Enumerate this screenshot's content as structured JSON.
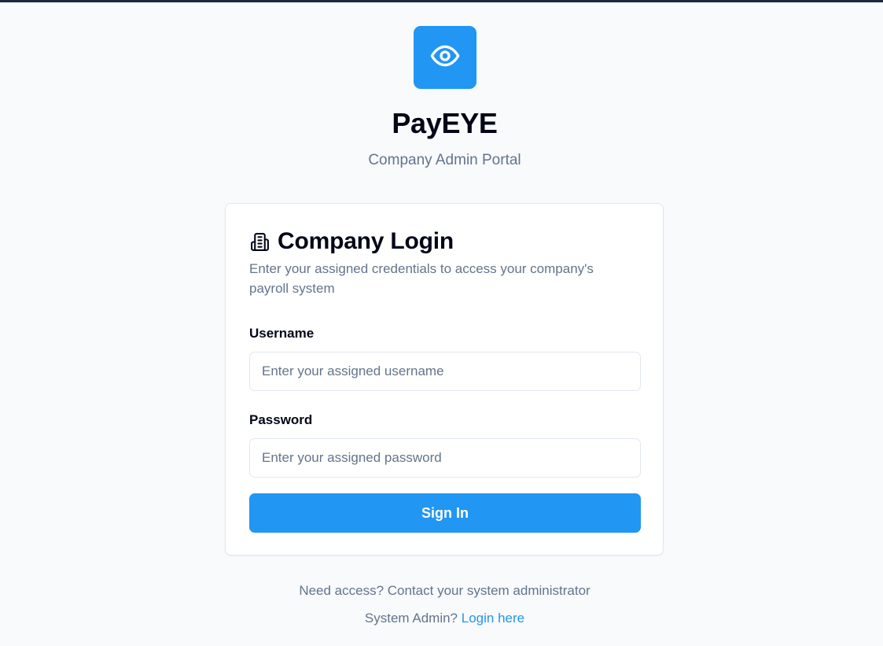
{
  "brand": {
    "name": "PayEYE",
    "subtitle": "Company Admin Portal",
    "logo_icon": "eye-icon",
    "accent_color": "#2196f3"
  },
  "login_card": {
    "icon": "building-icon",
    "title": "Company Login",
    "description": "Enter your assigned credentials to access your company's payroll system",
    "username": {
      "label": "Username",
      "value": "",
      "placeholder": "Enter your assigned username"
    },
    "password": {
      "label": "Password",
      "value": "",
      "placeholder": "Enter your assigned password"
    },
    "submit_label": "Sign In"
  },
  "footer": {
    "access_text": "Need access? Contact your system administrator",
    "admin_prompt": "System Admin?",
    "admin_link": "Login here"
  }
}
